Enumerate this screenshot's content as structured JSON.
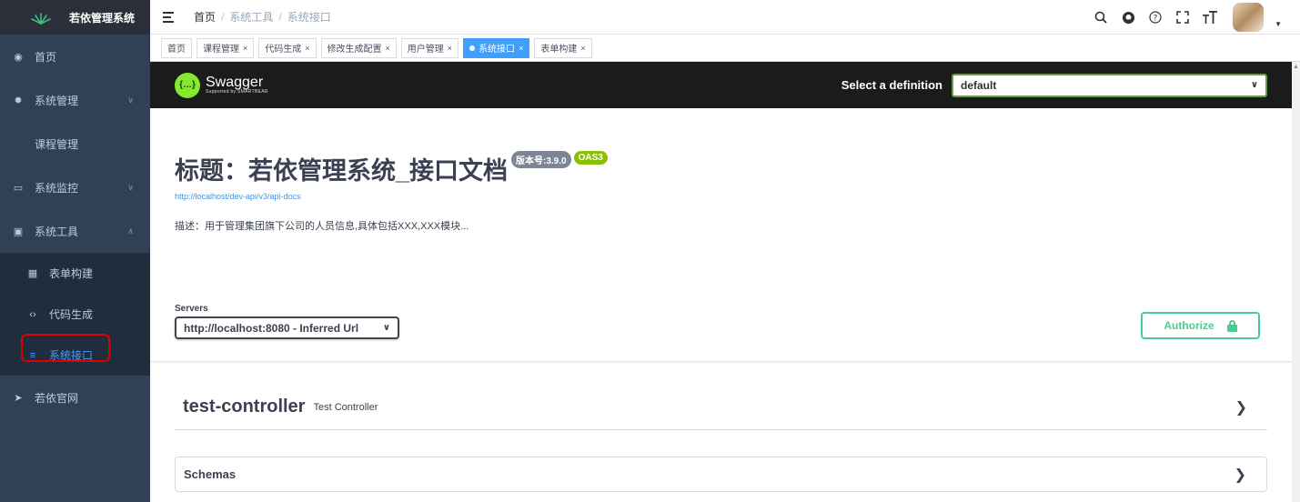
{
  "app": {
    "logo_text": "若依管理系统"
  },
  "sidebar": {
    "items": [
      {
        "label": "首页",
        "icon": "dashboard-icon"
      },
      {
        "label": "系统管理",
        "icon": "gear-icon"
      },
      {
        "label": "课程管理"
      },
      {
        "label": "系统监控",
        "icon": "monitor-icon"
      },
      {
        "label": "系统工具",
        "icon": "toolbox-icon"
      },
      {
        "label": "表单构建",
        "icon": "form-icon"
      },
      {
        "label": "代码生成",
        "icon": "code-icon"
      },
      {
        "label": "系统接口",
        "icon": "api-icon"
      },
      {
        "label": "若依官网",
        "icon": "send-icon"
      }
    ]
  },
  "breadcrumb": {
    "home": "首页",
    "level1": "系统工具",
    "level2": "系统接口",
    "sep": "/"
  },
  "tags": [
    {
      "label": "首页"
    },
    {
      "label": "课程管理"
    },
    {
      "label": "代码生成"
    },
    {
      "label": "修改生成配置"
    },
    {
      "label": "用户管理"
    },
    {
      "label": "系统接口"
    },
    {
      "label": "表单构建"
    }
  ],
  "swagger": {
    "brand": "Swagger",
    "brand_sub": "Supported by SMARTBEAR",
    "definition_label": "Select a definition",
    "definition_value": "default",
    "title": "标题：若依管理系统_接口文档",
    "version_badge": "版本号:3.9.0",
    "oas_badge": "OAS3",
    "url": "http://localhost/dev-api/v3/api-docs",
    "description": "描述：用于管理集团旗下公司的人员信息,具体包括XXX,XXX模块...",
    "servers_label": "Servers",
    "server_value": "http://localhost:8080 - Inferred Url",
    "authorize_label": "Authorize",
    "tag_name": "test-controller",
    "tag_desc": "Test Controller",
    "schemas_label": "Schemas"
  },
  "colors": {
    "sidebar_bg": "#304156",
    "accent": "#409eff",
    "swagger_green": "#85ea2d",
    "authorize": "#49cc90",
    "highlight": "#e00000"
  }
}
